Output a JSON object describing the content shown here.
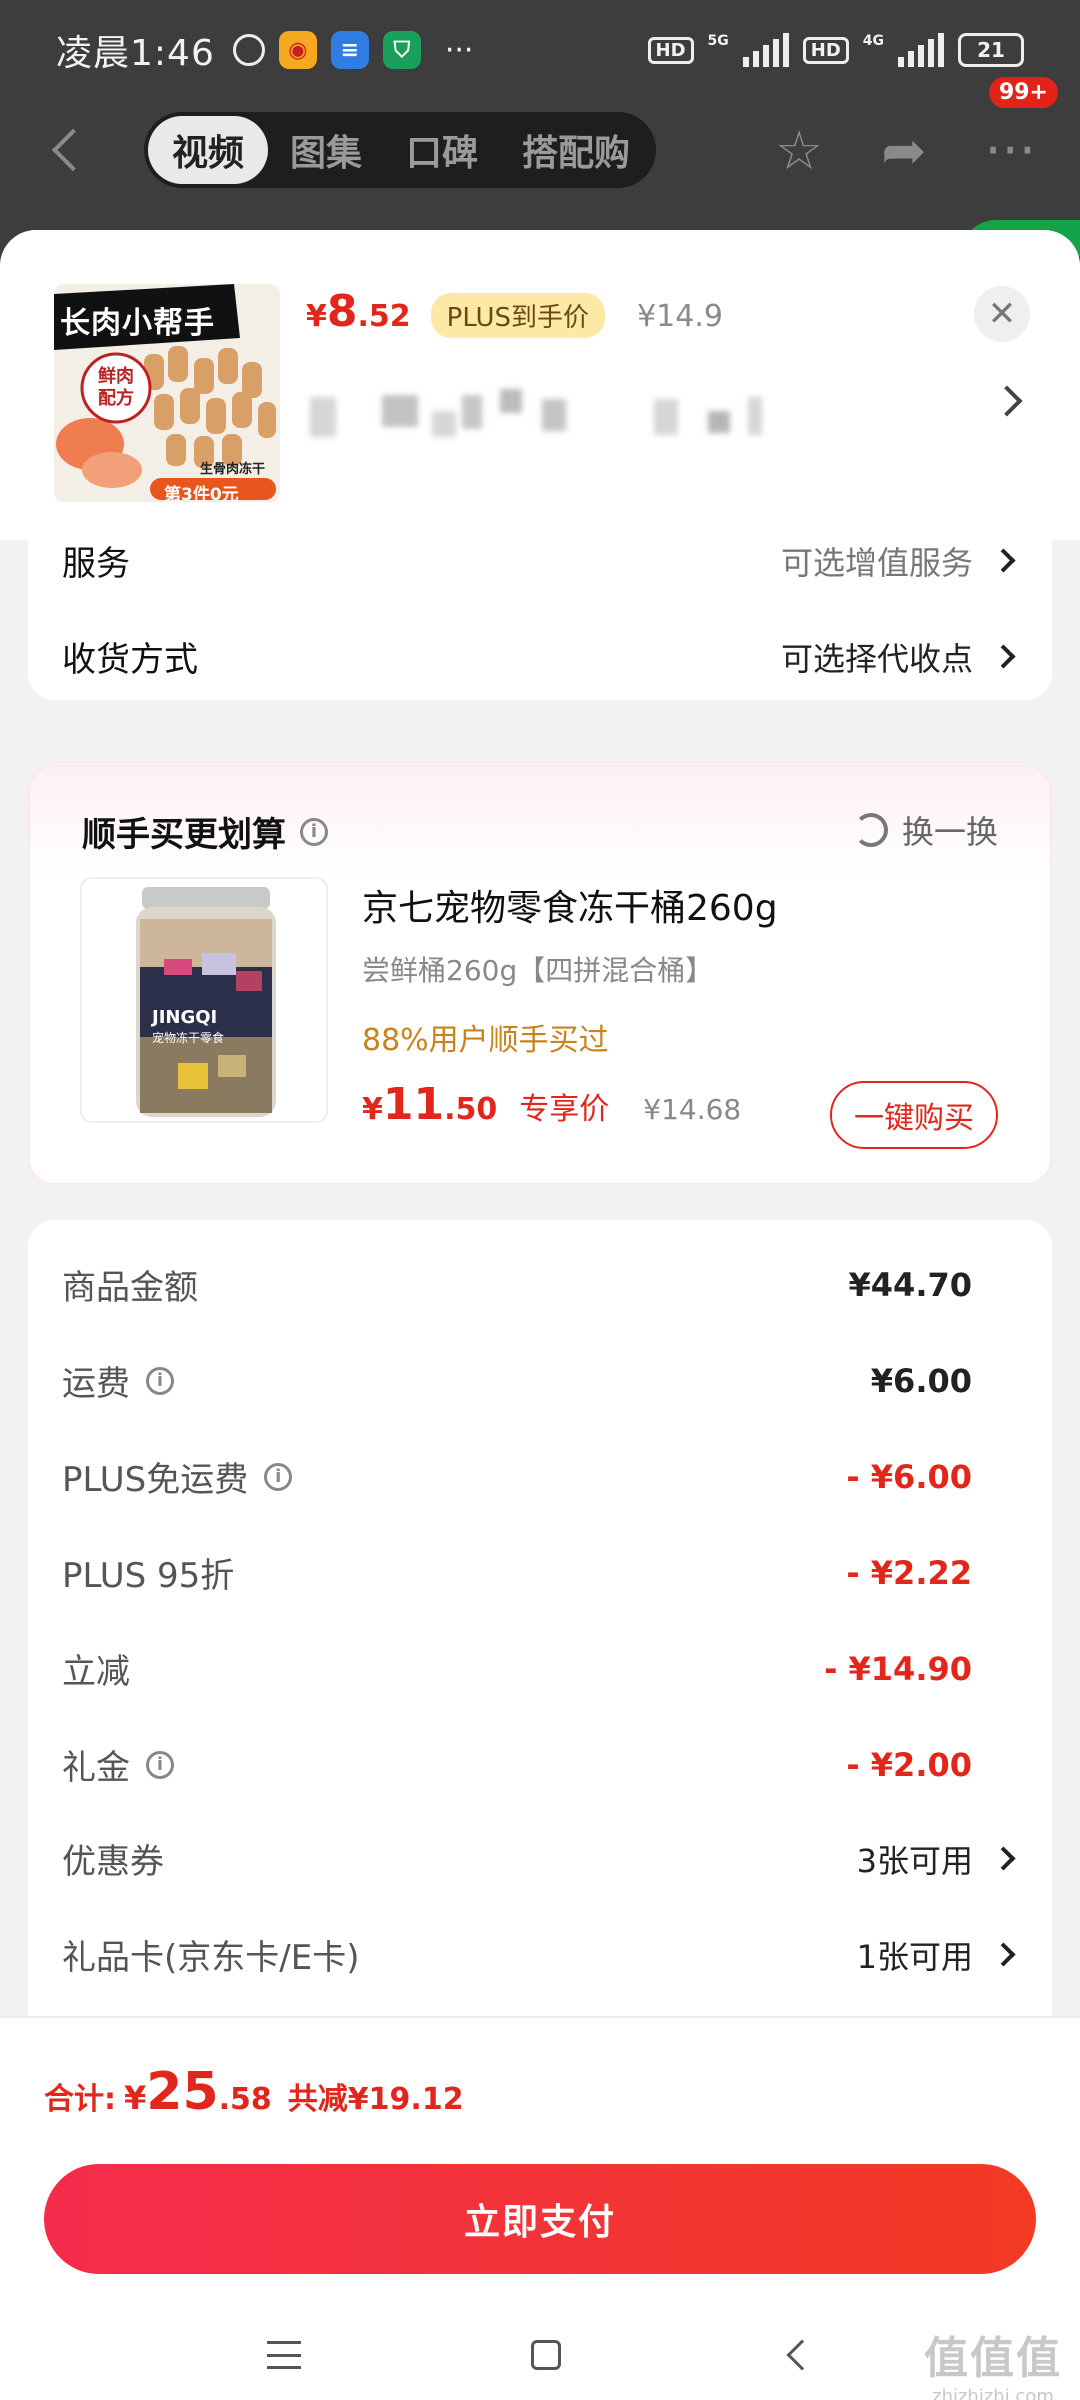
{
  "status_bar": {
    "time": "凌晨1:46",
    "signal1": "5G",
    "signal2": "4G",
    "hd": "HD",
    "battery": "21"
  },
  "top_nav": {
    "tabs": [
      "视频",
      "图集",
      "口碑",
      "搭配购"
    ],
    "active_tab": "视频",
    "badge": "99+"
  },
  "product": {
    "thumb_title": "长肉小帮手",
    "thumb_tag": "鲜肉配方",
    "thumb_caption": "生骨肉冻干",
    "thumb_promo": "第3件0元",
    "price_currency": "¥",
    "price_int": "8",
    "price_dec": ".52",
    "plus_label": "PLUS到手价",
    "original_price": "¥14.9"
  },
  "options": {
    "service_label": "服务",
    "service_value": "可选增值服务",
    "delivery_label": "收货方式",
    "delivery_value": "可选择代收点"
  },
  "upsell": {
    "title": "顺手买更划算",
    "swap_label": "换一换",
    "name": "京七宠物零食冻干桶260g",
    "spec": "尝鲜桶260g【四拼混合桶】",
    "percent_text": "88%用户顺手买过",
    "price_currency": "¥",
    "price_int": "11",
    "price_dec": ".50",
    "exclusive_label": "专享价",
    "original_price": "¥14.68",
    "buy_label": "一键购买",
    "jar_brand": "JINGQI",
    "jar_text": "宠物冻干零食"
  },
  "summary": {
    "rows": [
      {
        "label": "商品金额",
        "value": "¥44.70"
      },
      {
        "label": "运费",
        "value": "¥6.00"
      },
      {
        "label": "PLUS免运费",
        "value": "- ¥6.00"
      },
      {
        "label": "PLUS 95折",
        "value": "- ¥2.22"
      },
      {
        "label": "立减",
        "value": "- ¥14.90"
      },
      {
        "label": "礼金",
        "value": "- ¥2.00"
      },
      {
        "label": "优惠券",
        "value": "3张可用"
      },
      {
        "label": "礼品卡(京东卡/E卡)",
        "value": "1张可用"
      }
    ]
  },
  "bottom": {
    "total_label": "合计:",
    "total_currency": "¥",
    "total_int": "25",
    "total_dec": ".58",
    "saved": "共减¥19.12",
    "pay_label": "立即支付"
  },
  "watermark": {
    "main": "值值值",
    "sub": "zhizhizhi.com"
  },
  "colors": {
    "accent_red": "#e3261c",
    "plus_chip_bg": "#fce9a6",
    "upsell_percent": "#c9831c"
  }
}
